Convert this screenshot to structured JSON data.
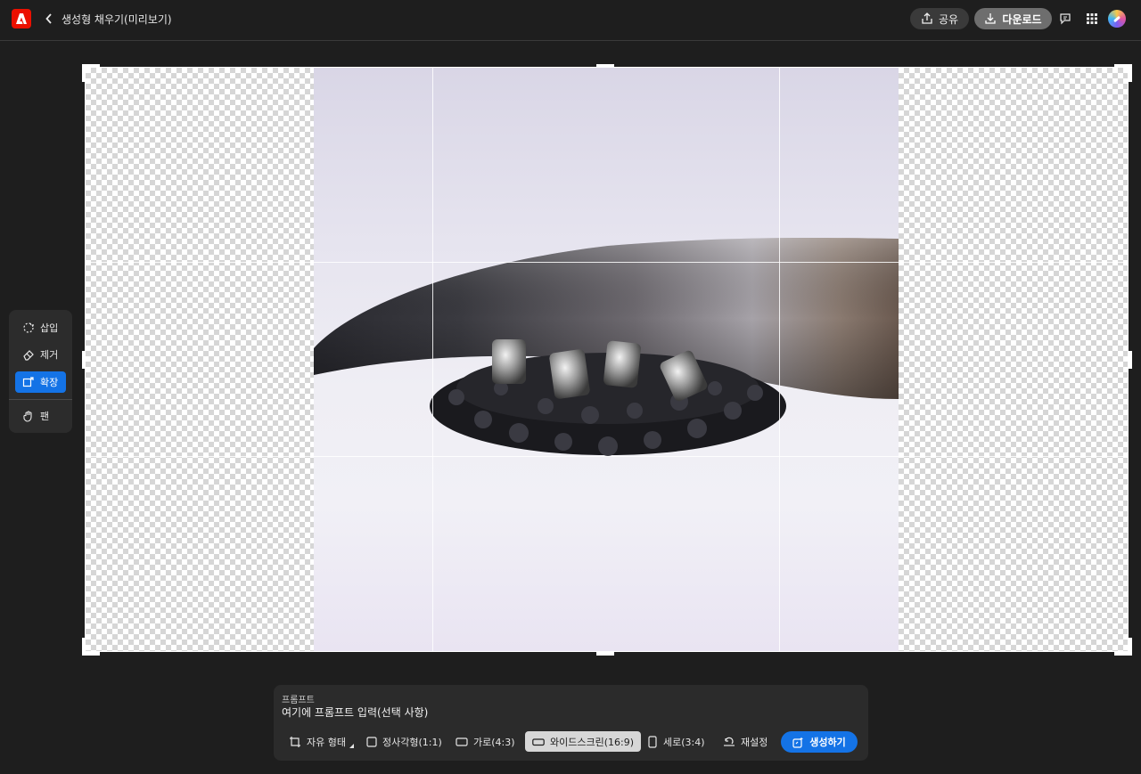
{
  "app": {
    "title": "생성형 채우기(미리보기)",
    "brand_color": "#eb1000",
    "logo_icon": "adobe-logo-icon"
  },
  "header": {
    "back_icon": "chevron-left-icon",
    "share_label": "공유",
    "download_label": "다운로드",
    "comment_icon": "comment-icon",
    "apps_icon": "apps-grid-icon"
  },
  "tools": {
    "items": [
      {
        "id": "insert",
        "label": "삽입",
        "icon": "insert-icon",
        "active": false
      },
      {
        "id": "remove",
        "label": "제거",
        "icon": "eraser-icon",
        "active": false
      },
      {
        "id": "expand",
        "label": "확장",
        "icon": "expand-icon",
        "active": true
      },
      {
        "id": "pan",
        "label": "팬",
        "icon": "hand-icon",
        "active": false
      }
    ]
  },
  "prompt": {
    "label": "프롬프트",
    "placeholder": "여기에 프롬프트 입력(선택 사항)",
    "value": ""
  },
  "aspect_options": {
    "free": "자유 형태",
    "square": "정사각형(1:1)",
    "landscape": "가로(4:3)",
    "widescreen": "와이드스크린(16:9)",
    "portrait": "세로(3:4)",
    "reset": "재설정",
    "selected": "widescreen"
  },
  "generate_label": "생성하기",
  "accent_color": "#1473e6"
}
